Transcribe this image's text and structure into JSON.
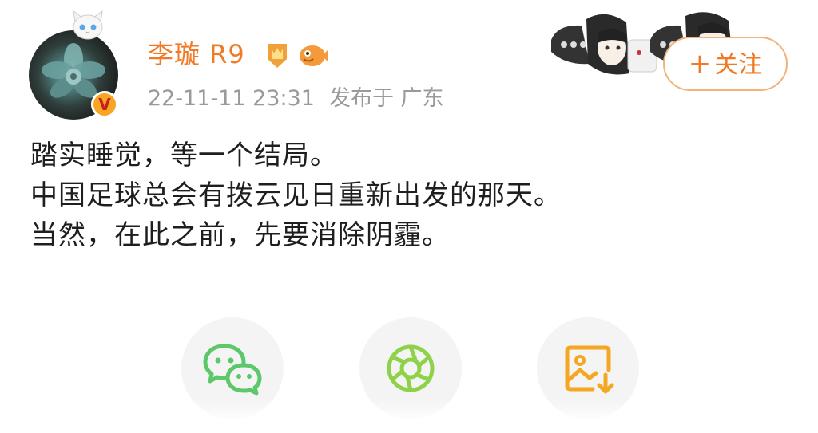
{
  "post": {
    "username": "李璇 R9",
    "timestamp": "22-11-11 23:31",
    "location": "发布于 广东",
    "follow_label": "关注",
    "follow_plus": "+",
    "verified_mark": "V",
    "lines": [
      "踏实睡觉，等一个结局。",
      "中国足球总会有拨云见日重新出发的那天。",
      "当然，在此之前，先要消除阴霾。"
    ]
  },
  "badges": [
    "gold-crown-badge-icon",
    "orange-fish-badge-icon"
  ],
  "share_buttons": [
    "wechat-icon",
    "moments-icon",
    "save-image-icon"
  ],
  "colors": {
    "accent": "#f07a25",
    "meta_text": "#9a9a9a",
    "wechat_green": "#5cc86a",
    "moments_green": "#8fd24a",
    "save_orange": "#f5a623"
  }
}
